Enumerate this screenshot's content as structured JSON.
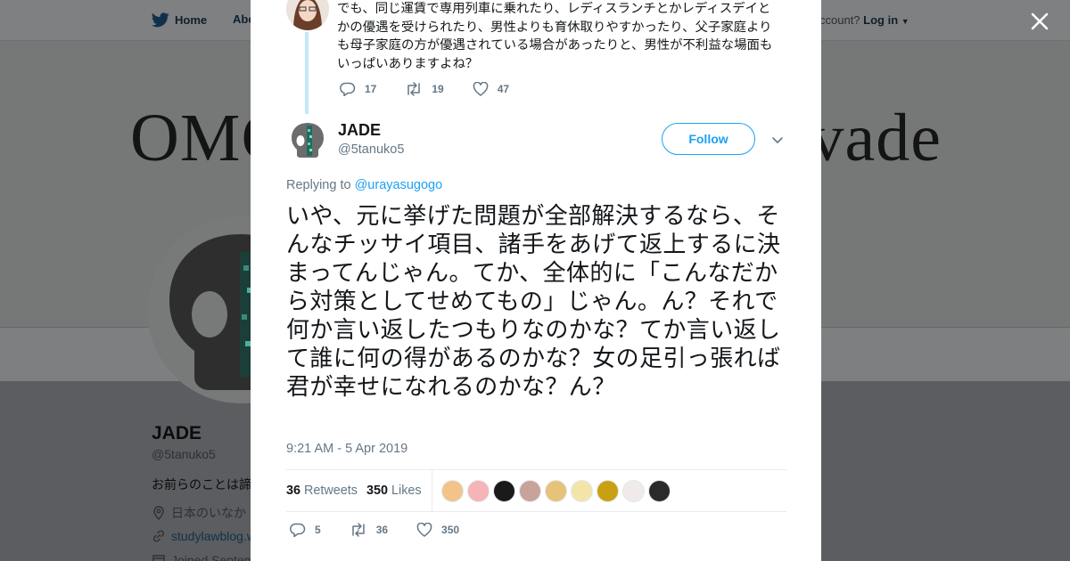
{
  "background": {
    "nav": {
      "home_label": "Home",
      "about_label": "Abo"
    },
    "account_prompt": "ccount?",
    "login_label": "Log in",
    "header_text_left": "OMG",
    "header_text_right": "vade",
    "profile": {
      "name": "JADE",
      "handle": "@5tanuko5",
      "bio": "お前らのことは諦",
      "location": "日本のいなか",
      "website": "studylawblog.w",
      "joined": "Joined Septem"
    }
  },
  "parent_tweet": {
    "text": "でも、同じ運賃で専用列車に乗れたり、レディスランチとかレディスデイとかの優遇を受けられたり、男性よりも育休取りやすかったり、父子家庭よりも母子家庭の方が優遇されている場合があったりと、男性が不利益な場面もいっぱいありますよね？",
    "replies": "17",
    "retweets": "19",
    "likes": "47"
  },
  "tweet": {
    "name": "JADE",
    "handle": "@5tanuko5",
    "follow_label": "Follow",
    "replying_prefix": "Replying to",
    "replying_to": "@urayasugogo",
    "text": "いや、元に挙げた問題が全部解決するなら、そんなチッサイ項目、諸手をあげて返上するに決まってんじゃん。てか、全体的に「こんなだから対策としてせめてもの」じゃん。ん？それで何か言い返したつもりなのかな？てか言い返して誰に何の得があるのかな？女の足引っ張れば君が幸せになれるのかな？ん？",
    "timestamp": "9:21 AM - 5 Apr 2019",
    "retweet_count": "36",
    "retweet_label": "Retweets",
    "like_count": "350",
    "like_label": "Likes",
    "reply_action_count": "5",
    "retweet_action_count": "36",
    "like_action_count": "350"
  },
  "liker_avatar_colors": [
    "#f2c48a",
    "#f6b3b8",
    "#1a1a1a",
    "#c9a29a",
    "#e7c27a",
    "#f3e5a9",
    "#c9a012",
    "#f0eaea",
    "#2a2a2a"
  ],
  "colors": {
    "accent": "#1da1f2",
    "overlay_bg": "#5b5d60",
    "text": "#14171a",
    "muted": "#657786"
  },
  "icons": [
    "twitter-bird-icon",
    "close-icon",
    "reply-icon",
    "retweet-icon",
    "heart-icon",
    "chevron-down-icon",
    "location-icon",
    "link-icon",
    "calendar-icon"
  ]
}
